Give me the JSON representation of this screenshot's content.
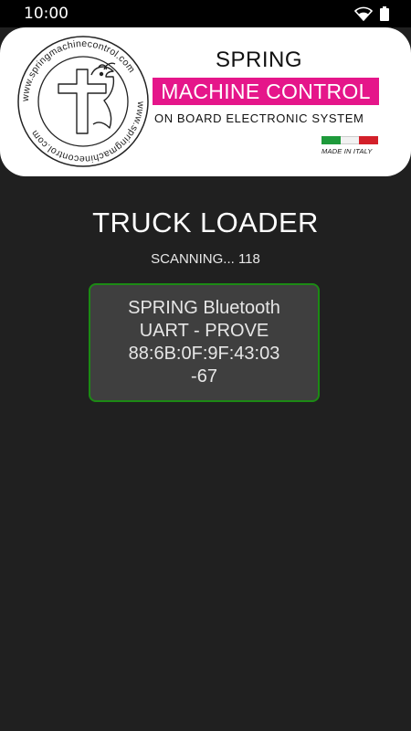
{
  "status_bar": {
    "time": "10:00"
  },
  "header": {
    "logo_url_text": "www.springmachinecontrol.com",
    "brand_title": "SPRING",
    "brand_subtitle": "MACHINE CONTROL",
    "brand_tagline": "ON BOARD ELECTRONIC SYSTEM",
    "made_in": "MADE IN ITALY",
    "accent_color": "#e5168a"
  },
  "page": {
    "title": "TRUCK LOADER",
    "scan_status": "SCANNING... 118"
  },
  "devices": [
    {
      "name_line1": "SPRING Bluetooth",
      "name_line2": "UART - PROVE",
      "address": "88:6B:0F:9F:43:03",
      "rssi": "-67"
    }
  ]
}
